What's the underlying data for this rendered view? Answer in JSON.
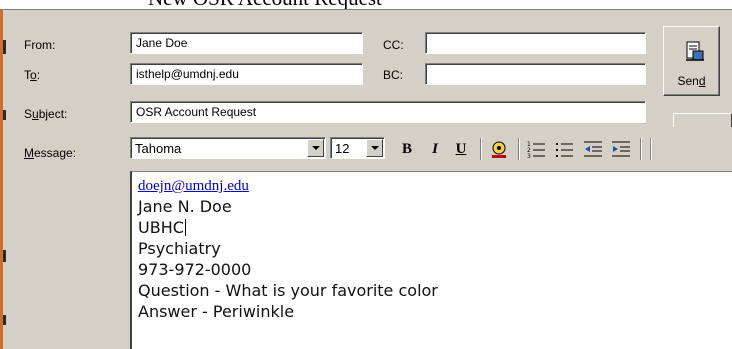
{
  "document_heading": "New OSR Account Request",
  "labels": {
    "from": "From:",
    "to_prefix": "T",
    "to_mnemonic": "o",
    "to_suffix": ":",
    "cc": "CC:",
    "bc": "BC:",
    "subject_prefix": "S",
    "subject_mnemonic": "u",
    "subject_suffix": "bject:",
    "message_mnemonic": "M",
    "message_suffix": "essage:"
  },
  "fields": {
    "from": "Jane Doe",
    "to": "isthelp@umdnj.edu",
    "cc": "",
    "bc": "",
    "subject": "OSR Account Request"
  },
  "send_button": {
    "label_prefix": "Sen",
    "label_mnemonic": "d",
    "icon": "send-mail-icon"
  },
  "toolbar": {
    "font_name": "Tahoma",
    "font_size": "12",
    "bold": "B",
    "italic": "I",
    "underline": "U",
    "icons": [
      "bold-icon",
      "italic-icon",
      "underline-icon",
      "font-color-icon",
      "numbered-list-icon",
      "bulleted-list-icon",
      "decrease-indent-icon",
      "increase-indent-icon"
    ]
  },
  "message": {
    "email_link": "doejn@umdnj.edu",
    "lines": [
      "Jane N. Doe",
      "UBHC",
      "Psychiatry",
      "973-972-0000",
      "Question - What is your favorite color",
      "Answer - Periwinkle"
    ]
  },
  "colors": {
    "chrome": "#d4d0c8",
    "accent_left_border": "#d96a1f",
    "link": "#0000cc"
  }
}
